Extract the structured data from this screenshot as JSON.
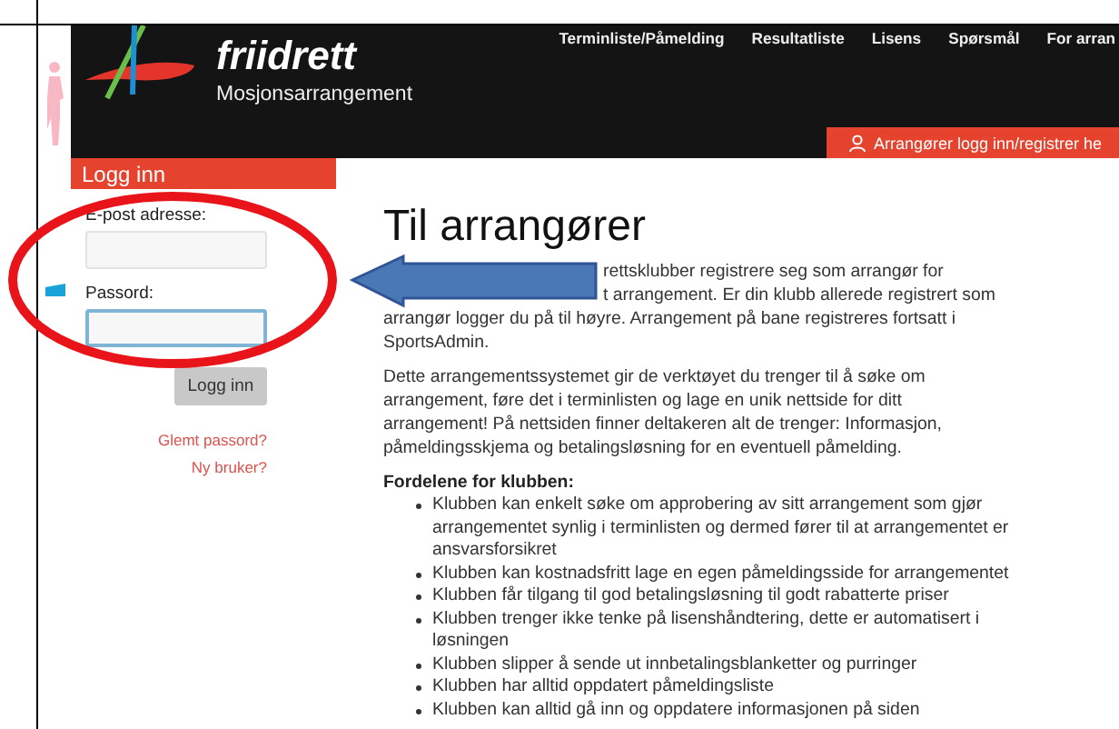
{
  "header": {
    "logo_title": "friidrett",
    "logo_subtitle": "Mosjonsarrangement",
    "nav": [
      "Terminliste/Påmelding",
      "Resultatliste",
      "Lisens",
      "Spørsmål",
      "For arran"
    ],
    "organizer_login": "Arrangører logg inn/registrer he"
  },
  "login": {
    "title": "Logg inn",
    "fields": [
      {
        "label": "E-post adresse:",
        "focused": false
      },
      {
        "label": "Passord:",
        "focused": true
      }
    ],
    "submit": "Logg inn",
    "links": [
      "Glemt passord?",
      "Ny bruker?"
    ]
  },
  "content": {
    "heading": "Til arrangører",
    "intro_lines": [
      {
        "text": "rettsklubber registrere seg som arrangør for",
        "covered": true
      },
      {
        "text": "t arrangement. Er din klubb allerede registrert som",
        "covered": true
      },
      {
        "text": "arrangør logger du på til høyre. Arrangement på bane registreres fortsatt i",
        "covered": false
      },
      {
        "text": "SportsAdmin.",
        "covered": false
      }
    ],
    "paragraph": "Dette arrangementssystemet gir de verktøyet du trenger til å søke om arrangement, føre det i terminlisten og lage en unik nettside for ditt arrangement! På nettsiden finner deltakeren alt de trenger: Informasjon, påmeldingsskjema og betalingsløsning for en eventuell påmelding.",
    "benefits_title": "Fordelene for klubben:",
    "benefits": [
      "Klubben kan enkelt søke om approbering av sitt arrangement som gjør arrangementet synlig i terminlisten og dermed fører til at arrangementet er ansvarsforsikret",
      "Klubben kan kostnadsfritt lage en egen påmeldingsside for arrangementet",
      "Klubben får tilgang til god betalingsløsning til godt rabatterte priser",
      "Klubben trenger ikke tenke på lisenshåndtering, dette er automatisert i løsningen",
      "Klubben slipper å sende ut innbetalingsblanketter og purringer",
      "Klubben har alltid oppdatert påmeldingsliste",
      "Klubben kan alltid gå inn og oppdatere informasjonen på siden"
    ]
  }
}
